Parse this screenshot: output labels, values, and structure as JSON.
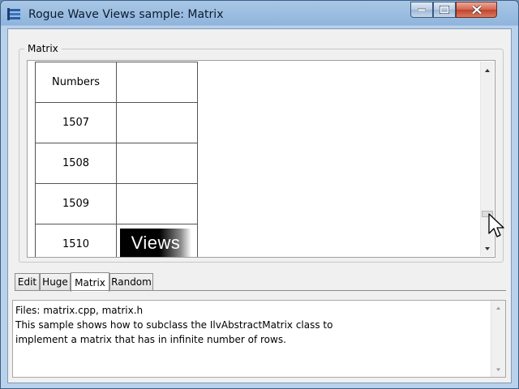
{
  "window": {
    "title": "Rogue Wave Views sample: Matrix"
  },
  "matrix_panel": {
    "group_label": "Matrix",
    "header_cell": "Numbers",
    "rows": [
      "1507",
      "1508",
      "1509",
      "1510"
    ],
    "views_logo_text": "Views"
  },
  "tabs": [
    {
      "label": "Edit"
    },
    {
      "label": "Huge"
    },
    {
      "label": "Matrix",
      "active": true
    },
    {
      "label": "Random"
    }
  ],
  "description": {
    "text": "Files: matrix.cpp, matrix.h\nThis sample shows how to subclass the IlvAbstractMatrix class to\nimplement a matrix that has in infinite number of rows."
  },
  "colors": {
    "title_bar": "#8fb4dc",
    "close_button": "#c0432c"
  }
}
